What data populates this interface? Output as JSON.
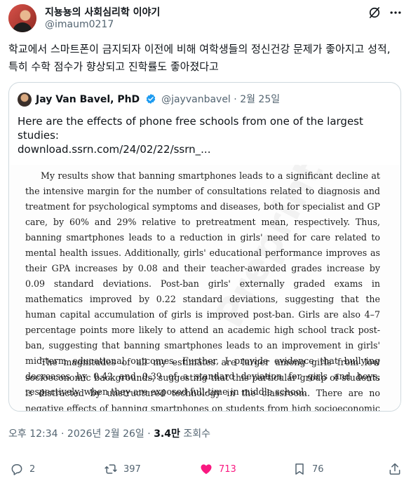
{
  "author": {
    "name": "지뇽뇽의 사회심리학 이야기",
    "handle": "@imaum0217"
  },
  "tweet_text": "학교에서 스마트폰이 금지되자 이전에 비해 여학생들의 정신건강 문제가 좋아지고 성적, 특히 수학 점수가 향상되고 진학률도 좋아졌다고",
  "quote": {
    "name": "Jay Van Bavel, PhD",
    "handle": "@jayvanbavel",
    "separator": "·",
    "date": "2월 25일",
    "text": "Here are the effects of phone free schools from one of the largest studies:",
    "link": "download.ssrn.com/24/02/22/ssrn_...",
    "paper_p1": "My results show that banning smartphones leads to a significant decline at the intensive margin for the number of consultations related to diagnosis and treatment for psychological symptoms and diseases, both for specialist and GP care, by 60% and 29% relative to pretreatment mean, respectively. Thus, banning smartphones leads to a reduction in girls' need for care related to mental health issues. Additionally, girls' educational performance improves as their GPA increases by 0.08 and their teacher-awarded grades increase by 0.09 standard deviations. Post-ban girls' externally graded exams in mathematics improved by 0.22 standard deviations, suggesting that the human capital accumulation of girls is improved post-ban. Girls are also 4–7 percentage points more likely to attend an academic high school track post-ban, suggesting that banning smartphones leads to an improvement in girls' mid-term educational outcomes. Further, I provide evidence that bullying decreases by 0.42 and 0.39 of a standard deviation for girls and boys, respectively, when they are exposed full-time in middle school.",
    "paper_p2": "The magnitudes of all my estimates are larger among girls from low socioeconomic backgrounds, suggesting that this particular group of students is distracted by unstructured technology in the classroom. There are no negative effects of banning smartphones on students from high socioeconomic families, or on boys."
  },
  "meta": {
    "time": "오후 12:34",
    "dot": "·",
    "date": "2026년 2월 26일",
    "views": "3.4만",
    "views_label": "조회수"
  },
  "actions": {
    "replies": "2",
    "retweets": "397",
    "likes": "713",
    "bookmarks": "76"
  },
  "colors": {
    "like": "#f91880",
    "verified": "#1d9bf0",
    "secondary": "#536471"
  }
}
